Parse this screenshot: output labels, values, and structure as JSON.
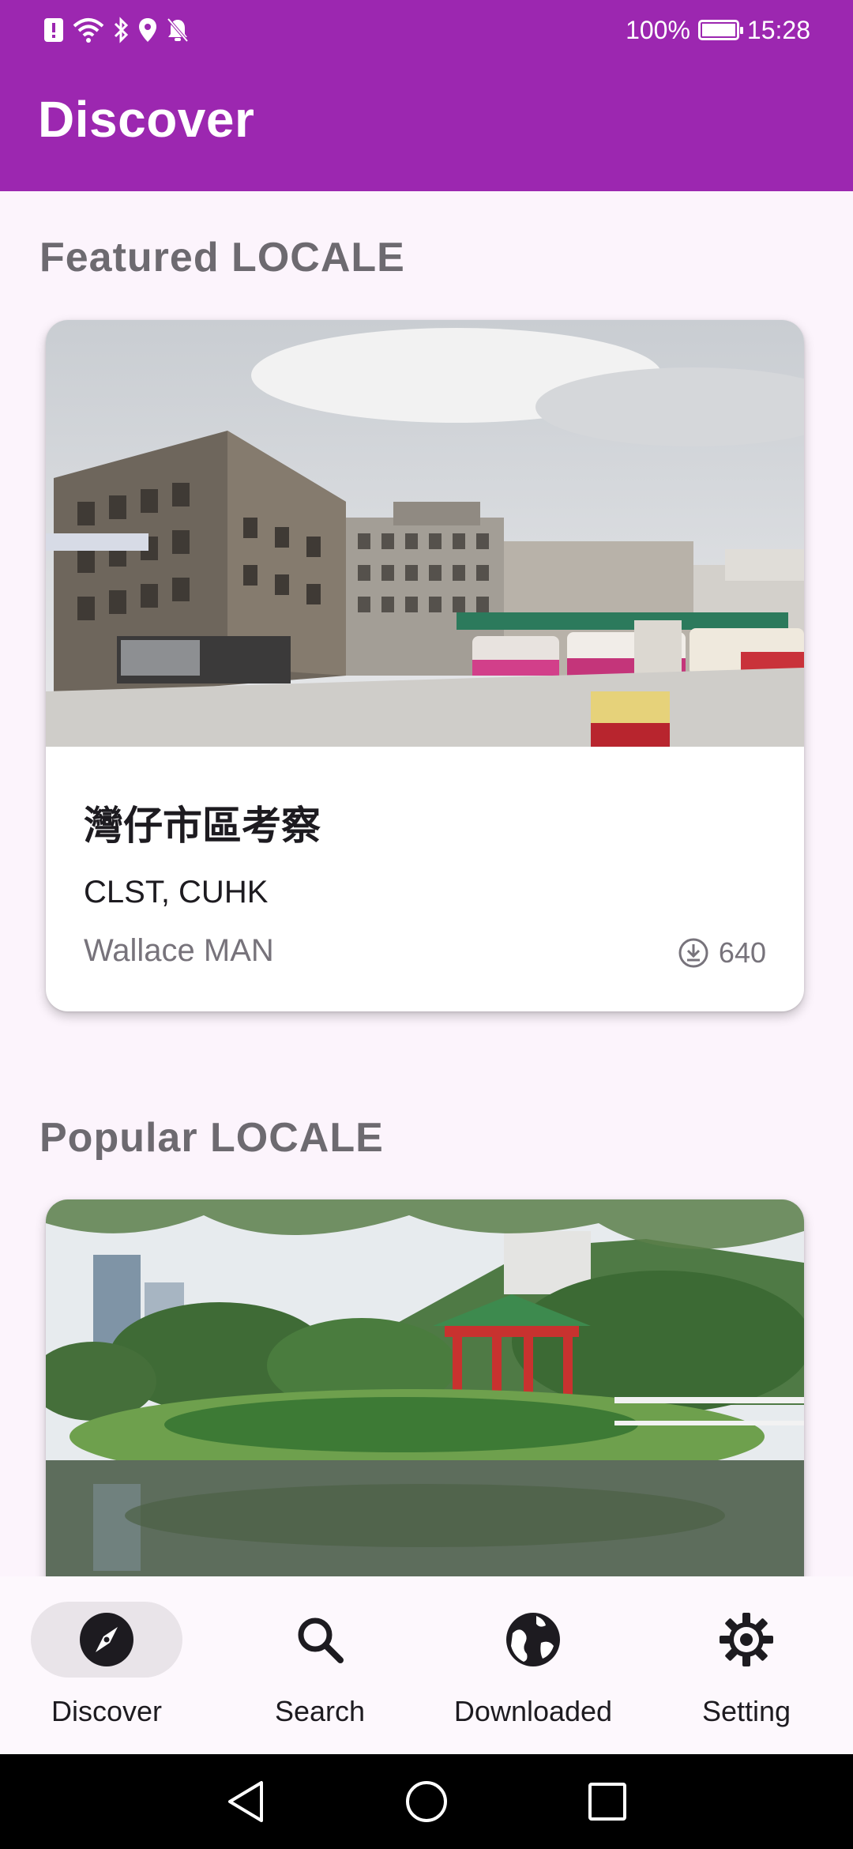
{
  "status_bar": {
    "battery": "100%",
    "time": "15:28",
    "icons": [
      "alert-icon",
      "wifi-icon",
      "bluetooth-icon",
      "location-icon",
      "bell-off-icon"
    ]
  },
  "app_bar": {
    "title": "Discover"
  },
  "featured": {
    "section_title": "Featured LOCALE",
    "card": {
      "title": "灣仔市區考察",
      "organization": "CLST, CUHK",
      "author": "Wallace MAN",
      "downloads": "640"
    }
  },
  "popular": {
    "section_title": "Popular LOCALE"
  },
  "bottom_nav": {
    "items": [
      {
        "label": "Discover",
        "icon": "compass-icon",
        "active": true
      },
      {
        "label": "Search",
        "icon": "search-icon",
        "active": false
      },
      {
        "label": "Downloaded",
        "icon": "globe-icon",
        "active": false
      },
      {
        "label": "Setting",
        "icon": "gear-icon",
        "active": false
      }
    ]
  },
  "colors": {
    "primary": "#9c27b0",
    "background": "#fcf4fc",
    "nav_active_pill": "#e9e4e9"
  }
}
